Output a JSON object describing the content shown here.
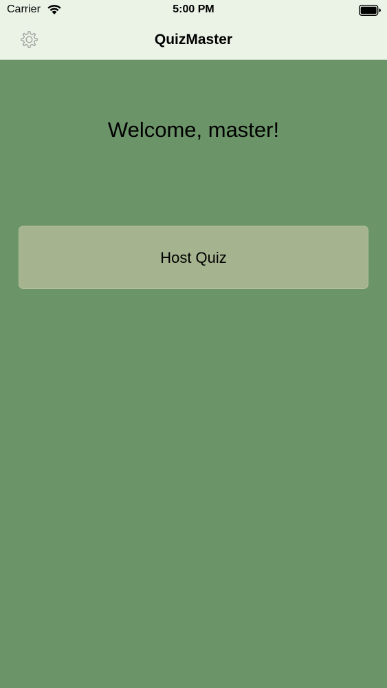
{
  "status_bar": {
    "carrier": "Carrier",
    "time": "5:00 PM",
    "wifi_icon": "wifi-icon",
    "battery_icon": "battery-icon"
  },
  "nav_bar": {
    "title": "QuizMaster",
    "settings_icon": "gear-icon"
  },
  "main": {
    "welcome_text": "Welcome, master!",
    "host_button_label": "Host Quiz"
  },
  "colors": {
    "background": "#6b9469",
    "bar_background": "#eaf3e6",
    "button_background": "#a5b38e",
    "icon_gray": "#9a9a9a"
  }
}
